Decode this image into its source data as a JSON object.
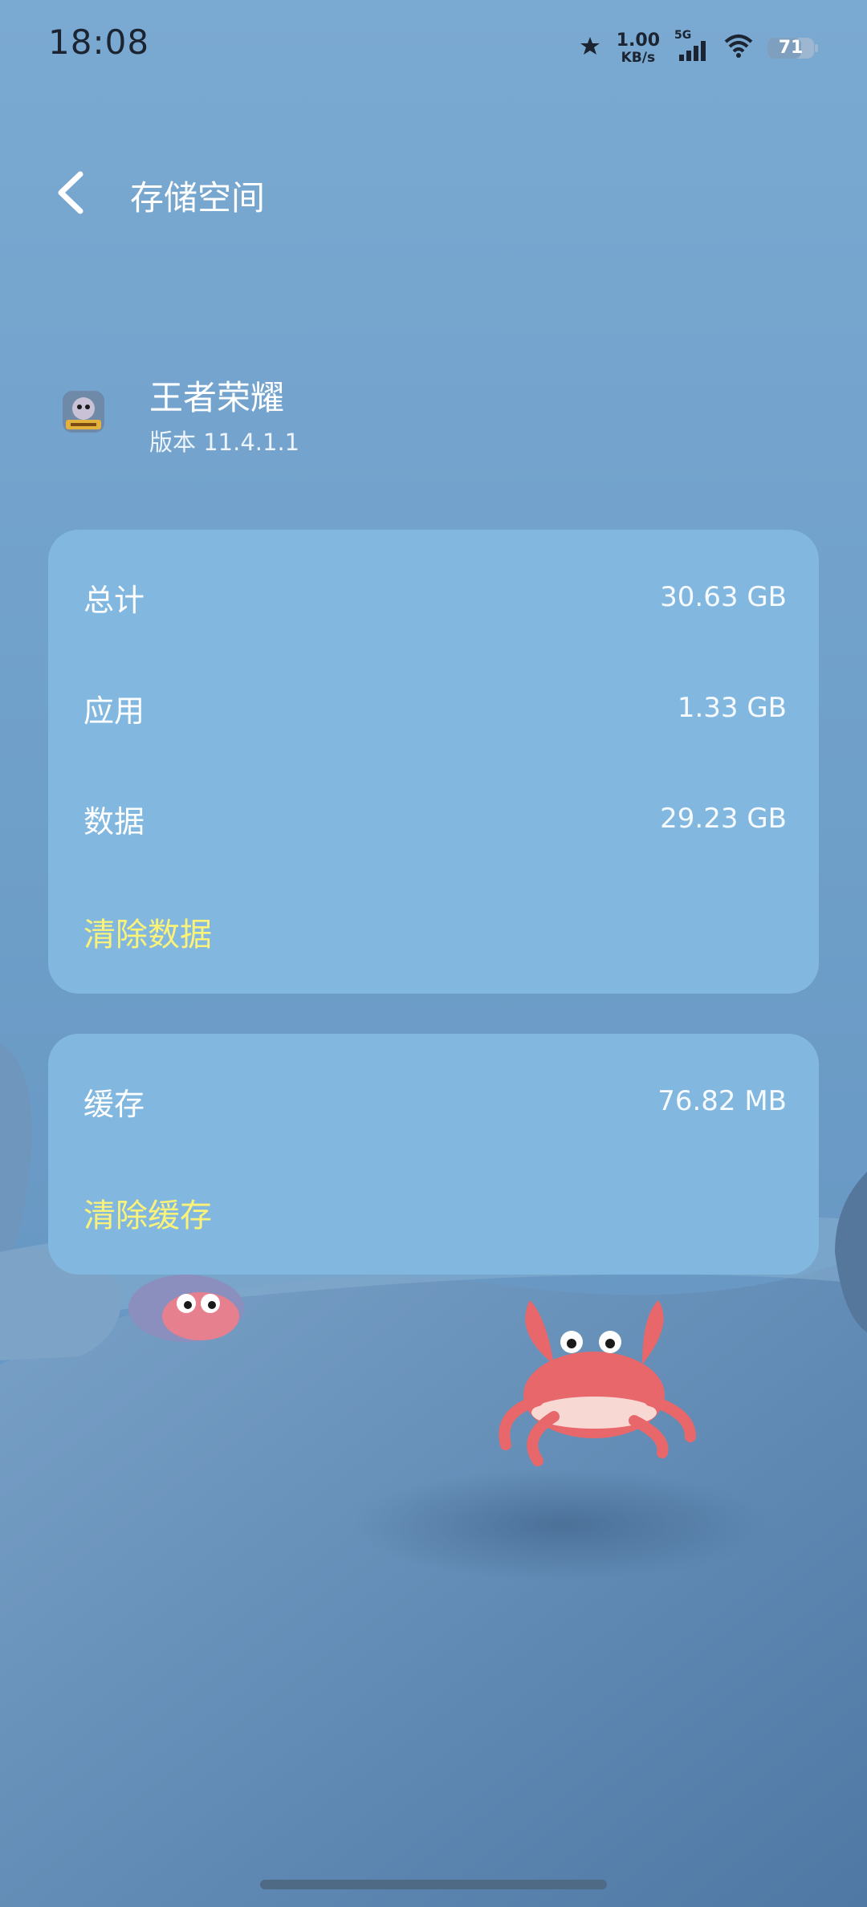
{
  "status_bar": {
    "time": "18:08",
    "net_speed_value": "1.00",
    "net_speed_unit": "KB/s",
    "signal_label": "5G",
    "battery_level": "71",
    "icons": [
      "alarm-icon",
      "signal-icon",
      "wifi-icon",
      "battery-icon"
    ]
  },
  "header": {
    "title": "存储空间",
    "back_icon": "chevron-left-icon"
  },
  "app": {
    "name": "王者荣耀",
    "version": "版本 11.4.1.1"
  },
  "storage": {
    "rows": [
      {
        "label": "总计",
        "value": "30.63 GB"
      },
      {
        "label": "应用",
        "value": "1.33 GB"
      },
      {
        "label": "数据",
        "value": "29.23 GB"
      }
    ],
    "clear_data_label": "清除数据"
  },
  "cache": {
    "label": "缓存",
    "value": "76.82 MB",
    "clear_cache_label": "清除缓存"
  },
  "colors": {
    "card": "#82b8df",
    "action": "#fbf27a",
    "background": "#6f9cc3"
  }
}
